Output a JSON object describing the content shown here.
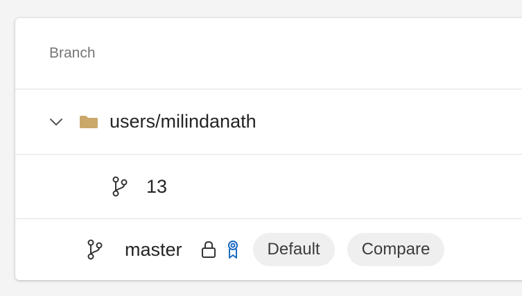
{
  "header": {
    "column_label": "Branch"
  },
  "folder": {
    "name": "users/milindanath",
    "expanded": true,
    "icon": "folder-icon",
    "color": "#c9a86a"
  },
  "branches": [
    {
      "name": "13",
      "icon": "git-branch-icon"
    },
    {
      "name": "master",
      "icon": "git-branch-icon",
      "locked": true,
      "policy_icon": "ribbon-badge-icon",
      "tags": [
        "Default",
        "Compare"
      ]
    }
  ],
  "colors": {
    "text": "#242424",
    "muted": "#767676",
    "accent": "#1b6bc2",
    "pill_bg": "#efefef"
  }
}
